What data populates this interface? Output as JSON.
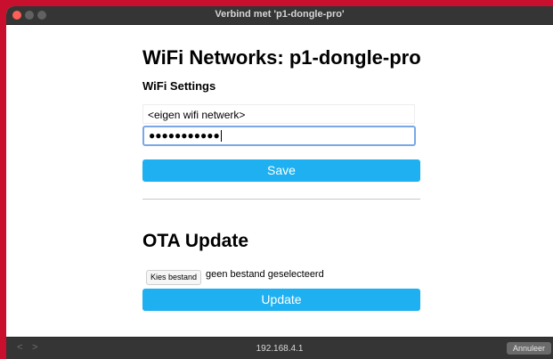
{
  "window": {
    "title": "Verbind met 'p1-dongle-pro'"
  },
  "page": {
    "heading": "WiFi Networks: p1-dongle-pro",
    "wifi_settings_label": "WiFi Settings",
    "ssid_value": "<eigen wifi netwerk>",
    "password_value": "●●●●●●●●●●●",
    "save_label": "Save",
    "ota_heading": "OTA Update",
    "file_button_label": "Kies bestand",
    "file_status": "geen bestand geselecteerd",
    "update_label": "Update"
  },
  "bottombar": {
    "back_icon": "chevron-left-icon",
    "forward_icon": "chevron-right-icon",
    "back_glyph": "<",
    "forward_glyph": ">",
    "url": "192.168.4.1",
    "cancel_label": "Annuleer"
  },
  "colors": {
    "background": "#c8102e",
    "accent": "#1eb0f0",
    "close_dot": "#fe5f57",
    "titlebar": "#353535"
  }
}
